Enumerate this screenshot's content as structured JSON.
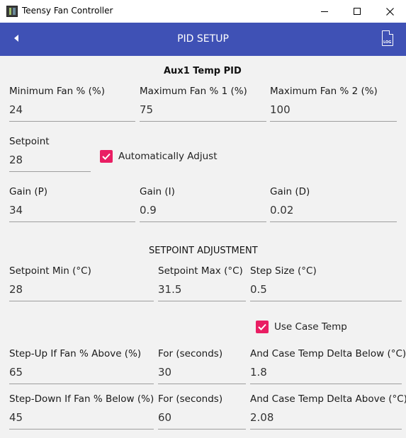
{
  "window": {
    "title": "Teensy Fan Controller"
  },
  "header": {
    "title": "PID SETUP",
    "log_label": "LOG"
  },
  "pid": {
    "title": "Aux1 Temp PID",
    "min_fan": {
      "label": "Minimum Fan % (%)",
      "value": "24"
    },
    "max_fan_1": {
      "label": "Maximum Fan % 1 (%)",
      "value": "75"
    },
    "max_fan_2": {
      "label": "Maximum Fan % 2 (%)",
      "value": "100"
    },
    "setpoint": {
      "label": "Setpoint",
      "value": "28"
    },
    "auto_adjust": {
      "label": "Automatically Adjust",
      "checked": true
    },
    "gain_p": {
      "label": "Gain (P)",
      "value": "34"
    },
    "gain_i": {
      "label": "Gain (I)",
      "value": "0.9"
    },
    "gain_d": {
      "label": "Gain (D)",
      "value": "0.02"
    }
  },
  "setpoint_adjustment": {
    "title": "SETPOINT ADJUSTMENT",
    "min": {
      "label": "Setpoint Min (°C)",
      "value": "28"
    },
    "max": {
      "label": "Setpoint Max (°C)",
      "value": "31.5"
    },
    "step": {
      "label": "Step Size (°C)",
      "value": "0.5"
    },
    "use_case_temp": {
      "label": "Use Case Temp",
      "checked": true
    },
    "step_up_fan": {
      "label": "Step-Up If Fan % Above (%)",
      "value": "65"
    },
    "step_up_for": {
      "label": "For (seconds)",
      "value": "30"
    },
    "step_up_delta": {
      "label": "And Case Temp Delta Below (°C)",
      "value": "1.8"
    },
    "step_down_fan": {
      "label": "Step-Down If Fan % Below (%)",
      "value": "45"
    },
    "step_down_for": {
      "label": "For (seconds)",
      "value": "60"
    },
    "step_down_delta": {
      "label": "And Case Temp Delta Above (°C)",
      "value": "2.08"
    }
  },
  "colors": {
    "header_bg": "#3f51b5",
    "checkbox": "#e91e63",
    "underline": "#9e9e9e",
    "background": "#f2f2f2"
  }
}
